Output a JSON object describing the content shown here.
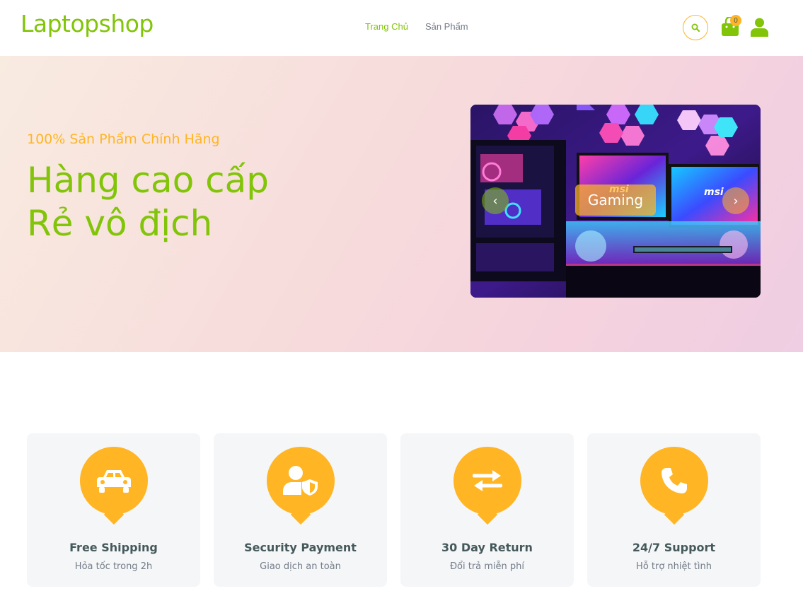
{
  "brand": {
    "logo": "Laptopshop"
  },
  "nav": {
    "items": [
      "Trang Chủ",
      "Sản Phẩm"
    ],
    "active_index": 0
  },
  "header": {
    "cart_count": "0",
    "icons": [
      "search-icon",
      "cart-icon",
      "user-icon"
    ]
  },
  "hero": {
    "subtitle": "100% Sản Phẩm Chính Hãng",
    "title_line1": "Hàng cao cấp",
    "title_line2": "Rẻ vô địch",
    "carousel": {
      "label": "Gaming",
      "brand_text": "msi"
    }
  },
  "features": [
    {
      "icon": "car-icon",
      "title": "Free Shipping",
      "subtitle": "Hỏa tốc trong 2h"
    },
    {
      "icon": "user-shield-icon",
      "title": "Security Payment",
      "subtitle": "Giao dịch an toàn"
    },
    {
      "icon": "exchange-icon",
      "title": "30 Day Return",
      "subtitle": "Đổi trả miễn phí"
    },
    {
      "icon": "phone-icon",
      "title": "24/7 Support",
      "subtitle": "Hỗ trợ nhiệt tình"
    }
  ],
  "colors": {
    "primary": "#81c408",
    "secondary": "#ffb524",
    "text": "#45595b",
    "muted": "#747d88"
  }
}
